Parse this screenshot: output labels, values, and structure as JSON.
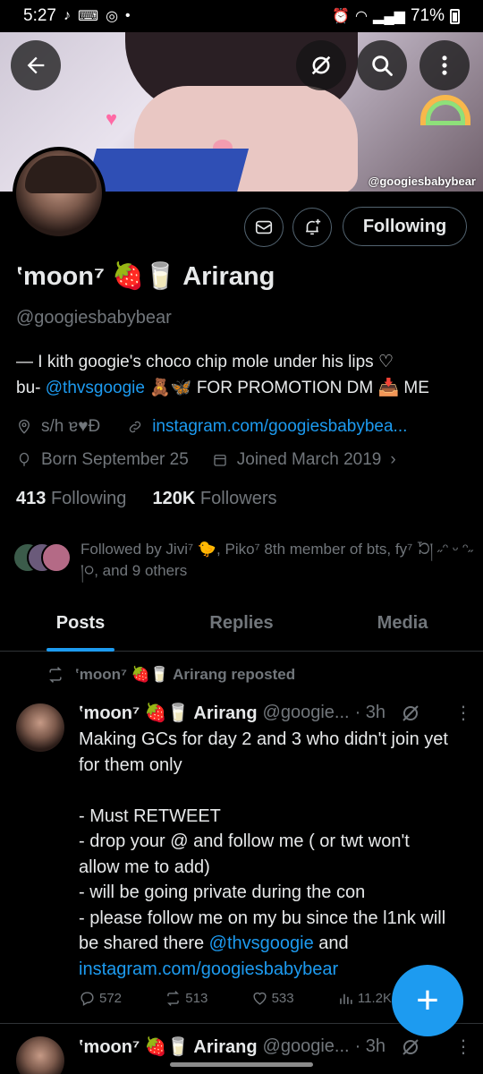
{
  "status": {
    "time": "5:27",
    "battery": "71%"
  },
  "banner": {
    "watermark": "@googiesbabybear"
  },
  "profile": {
    "name": "ʽmoon⁷ 🍓🥛 Arirang",
    "handle": "@googiesbabybear",
    "bio_line1": "— I kith googie's choco chip mole under his lips ♡",
    "bio_prefix": "bu- ",
    "bio_mention": "@thvsgoogie",
    "bio_suffix": " 🧸🦋 FOR PROMOTION DM 📥 ME",
    "location": "s/h ɐ♥Ɖ",
    "website": "instagram.com/googiesbabybea...",
    "born": "Born September 25",
    "joined": "Joined March 2019",
    "following_count": "413",
    "following_label": "Following",
    "followers_count": "120K",
    "followers_label": "Followers",
    "follow_button": "Following",
    "followed_by": "Followed by Jivi⁷ 🐤, Piko⁷ 8th member of bts, fy⁷ ᘶ། ˶ᵔ ᵕ ᵔ˶ །᳃, and 9 others"
  },
  "tabs": [
    "Posts",
    "Replies",
    "Media"
  ],
  "tweets": [
    {
      "repost_label": "ʽmoon⁷ 🍓🥛 Arirang reposted",
      "author": "ʽmoon⁷ 🍓🥛 Arirang",
      "handle": "@googie...",
      "time": "· 3h",
      "lines": [
        "Making GCs for day 2 and 3 who didn't join yet for them only",
        "",
        "- Must RETWEET",
        "- drop your @ and follow me ( or twt won't allow me to add)",
        "- will be going private during the con",
        "- please follow me on my bu since the l1nk will be shared there"
      ],
      "mention": "@thvsgoogie",
      "and_text": " and",
      "url": "instagram.com/googiesbabybear",
      "replies": "572",
      "retweets": "513",
      "likes": "533",
      "views": "11.2K"
    },
    {
      "author": "ʽmoon⁷ 🍓🥛 Arirang",
      "handle": "@googie...",
      "time": "· 3h"
    }
  ],
  "fab": "+"
}
